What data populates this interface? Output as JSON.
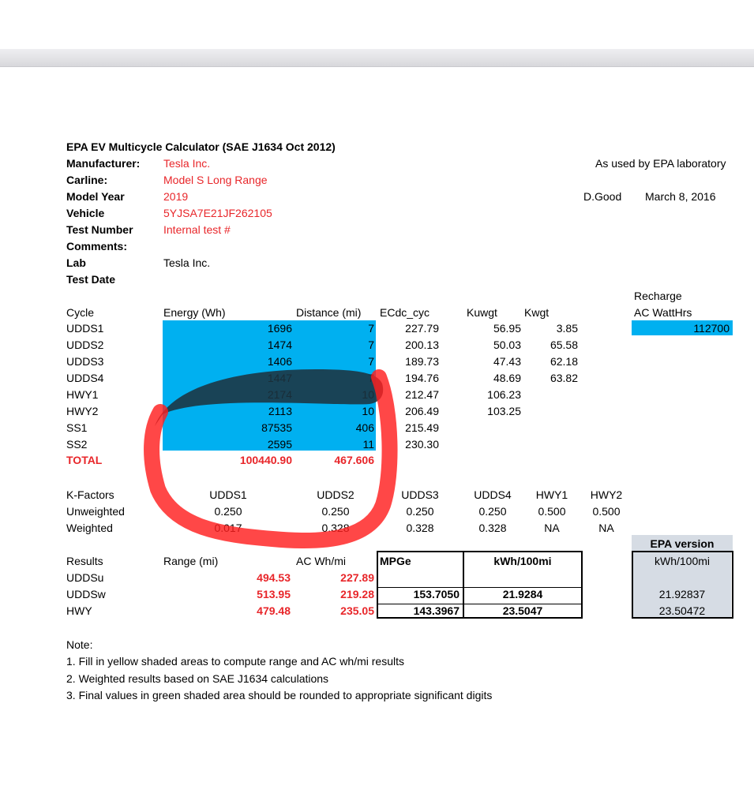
{
  "header": {
    "title": "EPA EV Multicycle Calculator (SAE J1634 Oct 2012)",
    "fields": [
      {
        "label": "Manufacturer:",
        "value": "Tesla Inc."
      },
      {
        "label": "Carline:",
        "value": "Model S Long Range"
      },
      {
        "label": "Model Year",
        "value": "2019"
      },
      {
        "label": "Vehicle",
        "value": "5YJSA7E21JF262105"
      },
      {
        "label": "Test Number",
        "value": "Internal test #"
      },
      {
        "label": "Comments:",
        "value": ""
      },
      {
        "label": "Lab",
        "value": "Tesla Inc."
      },
      {
        "label": "Test Date",
        "value": ""
      }
    ],
    "used_by": "As used by EPA laboratory",
    "author": "D.Good",
    "date": "March 8, 2016"
  },
  "cycles": {
    "headers": [
      "Cycle",
      "Energy (Wh)",
      "Distance (mi)",
      "ECdc_cyc",
      "Kuwgt",
      "Kwgt"
    ],
    "rows": [
      {
        "cycle": "UDDS1",
        "energy": "1696",
        "distance": "7",
        "ecdc": "227.79",
        "kuwgt": "56.95",
        "kwgt": "3.85"
      },
      {
        "cycle": "UDDS2",
        "energy": "1474",
        "distance": "7",
        "ecdc": "200.13",
        "kuwgt": "50.03",
        "kwgt": "65.58"
      },
      {
        "cycle": "UDDS3",
        "energy": "1406",
        "distance": "7",
        "ecdc": "189.73",
        "kuwgt": "47.43",
        "kwgt": "62.18"
      },
      {
        "cycle": "UDDS4",
        "energy": "1447",
        "distance": "7",
        "ecdc": "194.76",
        "kuwgt": "48.69",
        "kwgt": "63.82"
      },
      {
        "cycle": "HWY1",
        "energy": "2174",
        "distance": "10",
        "ecdc": "212.47",
        "kuwgt": "106.23",
        "kwgt": ""
      },
      {
        "cycle": "HWY2",
        "energy": "2113",
        "distance": "10",
        "ecdc": "206.49",
        "kuwgt": "103.25",
        "kwgt": ""
      },
      {
        "cycle": "SS1",
        "energy": "87535",
        "distance": "406",
        "ecdc": "215.49",
        "kuwgt": "",
        "kwgt": ""
      },
      {
        "cycle": "SS2",
        "energy": "2595",
        "distance": "11",
        "ecdc": "230.30",
        "kuwgt": "",
        "kwgt": ""
      }
    ],
    "total": {
      "label": "TOTAL",
      "energy": "100440.90",
      "distance": "467.606"
    },
    "recharge_label_1": "Recharge",
    "recharge_label_2": "AC WattHrs",
    "recharge_value": "112700"
  },
  "kfactors": {
    "label": "K-Factors",
    "headers": [
      "UDDS1",
      "UDDS2",
      "UDDS3",
      "UDDS4",
      "HWY1",
      "HWY2"
    ],
    "unweighted_label": "Unweighted",
    "unweighted": [
      "0.250",
      "0.250",
      "0.250",
      "0.250",
      "0.500",
      "0.500"
    ],
    "weighted_label": "Weighted",
    "weighted": [
      "0.017",
      "0.328",
      "0.328",
      "0.328",
      "NA",
      "NA"
    ]
  },
  "results": {
    "label": "Results",
    "range_header": "Range (mi)",
    "acwh_header": "AC Wh/mi",
    "mpge_header": "MPGe",
    "kwh_header": "kWh/100mi",
    "epa_version": "EPA version",
    "epa_kwh_header": "kWh/100mi",
    "rows": [
      {
        "label": "UDDSu",
        "range": "494.53",
        "acwh": "227.89",
        "mpge": "",
        "kwh": "",
        "epa": ""
      },
      {
        "label": "UDDSw",
        "range": "513.95",
        "acwh": "219.28",
        "mpge": "153.7050",
        "kwh": "21.9284",
        "epa": "21.92837"
      },
      {
        "label": "HWY",
        "range": "479.48",
        "acwh": "235.05",
        "mpge": "143.3967",
        "kwh": "23.5047",
        "epa": "23.50472"
      }
    ]
  },
  "notes": {
    "title": "Note:",
    "items": [
      "1. Fill in yellow shaded areas to compute range and AC wh/mi results",
      "2. Weighted results based on SAE J1634 calculations",
      "3. Final values in green shaded area should be rounded to appropriate significant digits"
    ]
  }
}
